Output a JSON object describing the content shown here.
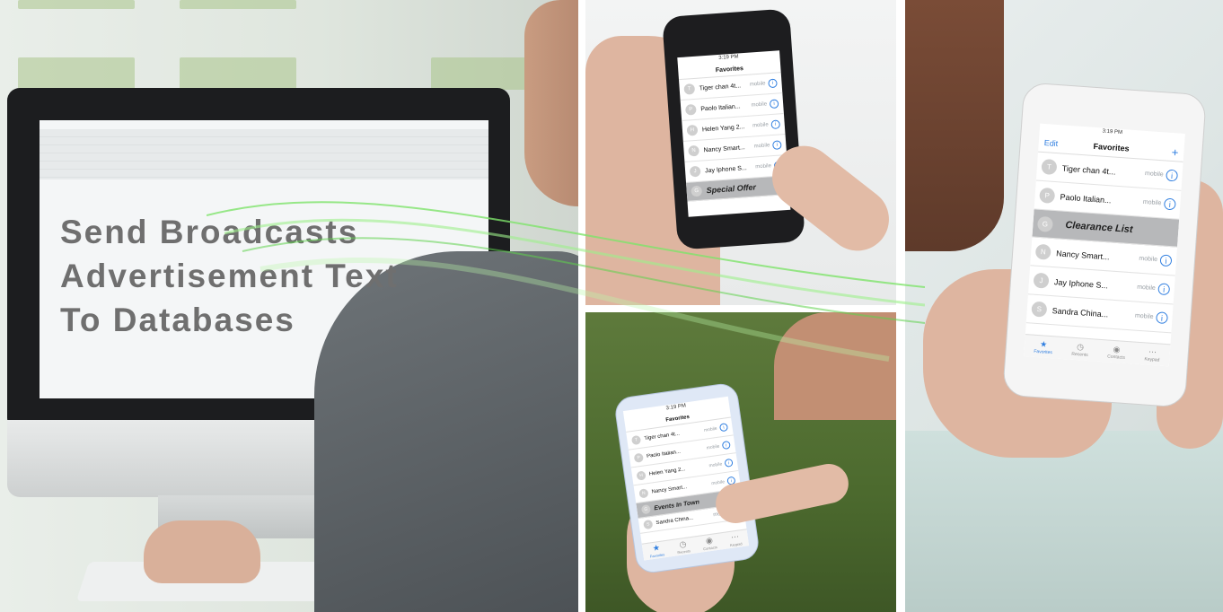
{
  "headline": {
    "line1": "Send Broadcasts",
    "line2": "Advertisement Text",
    "line3": "To Databases"
  },
  "colors": {
    "accent_blue": "#2f7ee0",
    "swoosh_green": "#7ee46a",
    "headline_gray": "#6f6f6f"
  },
  "phone_top": {
    "time": "3:19 PM",
    "title": "Favorites",
    "contacts": [
      {
        "initial": "T",
        "name": "Tiger chan 4t...",
        "label": "mobile"
      },
      {
        "initial": "P",
        "name": "Paolo Italian...",
        "label": "mobile"
      },
      {
        "initial": "H",
        "name": "Helen Yang 2...",
        "label": "mobile"
      },
      {
        "initial": "N",
        "name": "Nancy Smart...",
        "label": "mobile"
      },
      {
        "initial": "J",
        "name": "Jay Iphone S...",
        "label": "mobile"
      }
    ],
    "highlight": {
      "initial": "G",
      "name": "Special Offer"
    }
  },
  "phone_bottom": {
    "time": "3:19 PM",
    "title": "Favorites",
    "contacts": [
      {
        "initial": "T",
        "name": "Tiger chan 4t...",
        "label": "mobile"
      },
      {
        "initial": "P",
        "name": "Paolo Italian...",
        "label": "mobile"
      },
      {
        "initial": "H",
        "name": "Helen Yang 2...",
        "label": "mobile"
      },
      {
        "initial": "N",
        "name": "Nancy Smart...",
        "label": "mobile"
      }
    ],
    "highlight": {
      "initial": "G",
      "name": "Events In Town"
    },
    "after": {
      "initial": "S",
      "name": "Sandra China...",
      "label": "mobile"
    },
    "tabs": [
      "Favorites",
      "Recents",
      "Contacts",
      "Keypad"
    ]
  },
  "phone_right": {
    "time": "3:19 PM",
    "title": "Favorites",
    "edit": "Edit",
    "plus": "+",
    "contacts_before": [
      {
        "initial": "T",
        "name": "Tiger chan 4t...",
        "label": "mobile"
      },
      {
        "initial": "P",
        "name": "Paolo Italian...",
        "label": "mobile"
      }
    ],
    "highlight": {
      "initial": "G",
      "name": "Clearance List"
    },
    "contacts_after": [
      {
        "initial": "N",
        "name": "Nancy Smart...",
        "label": "mobile"
      },
      {
        "initial": "J",
        "name": "Jay Iphone S...",
        "label": "mobile"
      },
      {
        "initial": "S",
        "name": "Sandra China...",
        "label": "mobile"
      }
    ],
    "tabs": [
      "Favorites",
      "Recents",
      "Contacts",
      "Keypad"
    ]
  }
}
